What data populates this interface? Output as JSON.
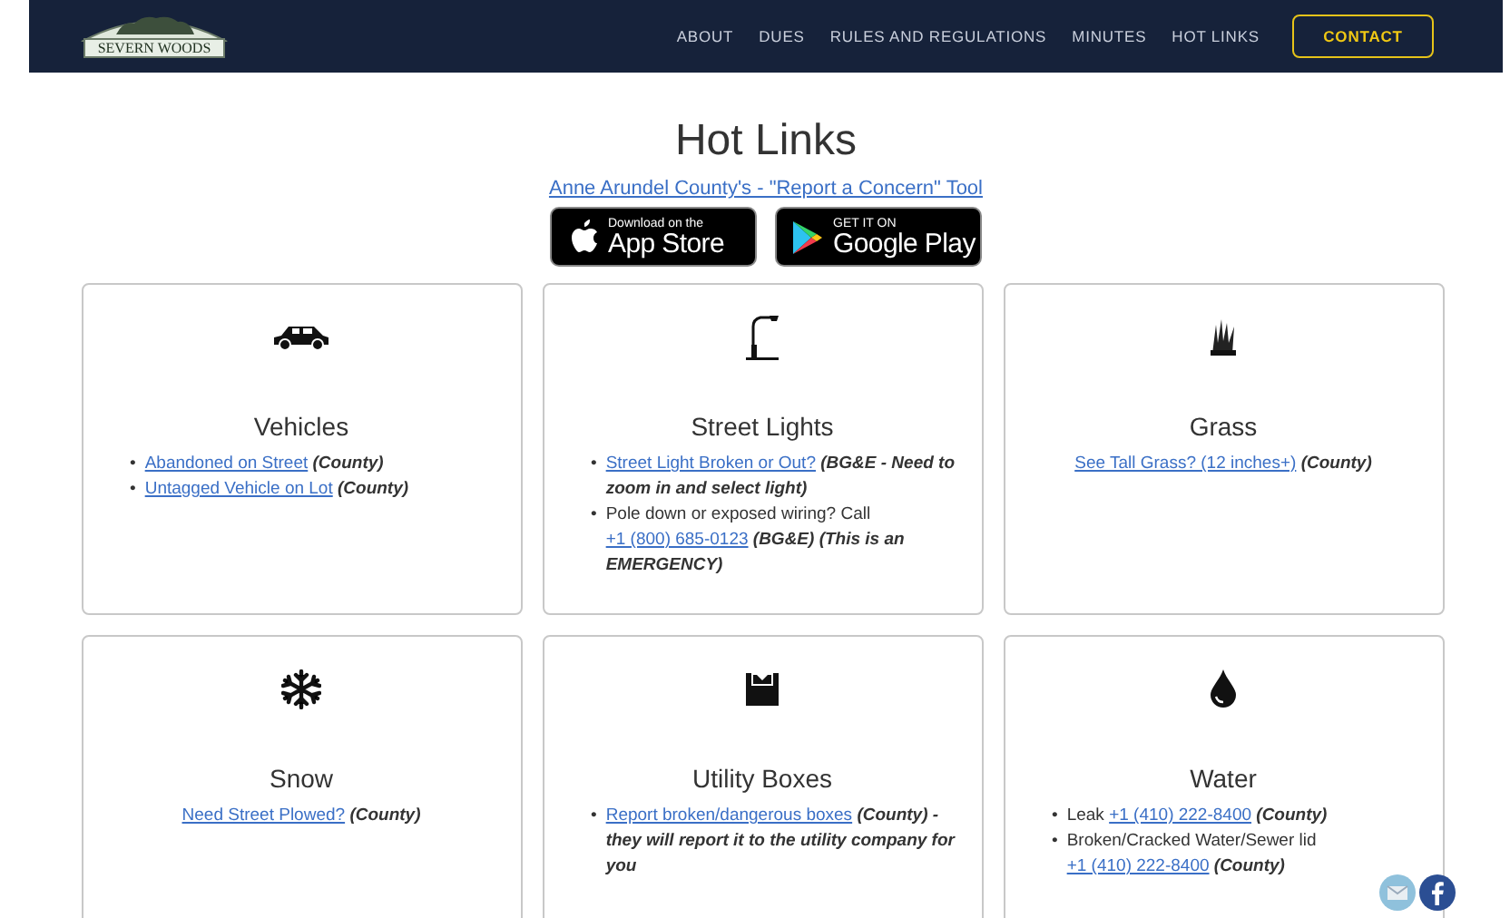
{
  "logo": {
    "text": "SEVERN WOODS"
  },
  "nav": {
    "links": [
      {
        "label": "ABOUT"
      },
      {
        "label": "DUES"
      },
      {
        "label": "RULES AND REGULATIONS"
      },
      {
        "label": "MINUTES"
      },
      {
        "label": "HOT LINKS"
      }
    ],
    "contact": "CONTACT"
  },
  "page": {
    "title": "Hot Links",
    "tool_link": "Anne Arundel County's - \"Report a Concern\" Tool",
    "badges": [
      {
        "kind": "apple",
        "top": "Download on the",
        "bottom": "App Store"
      },
      {
        "kind": "google",
        "top": "GET IT ON",
        "bottom": "Google Play"
      }
    ]
  },
  "cards": [
    {
      "title": "Vehicles",
      "items": [
        {
          "bullet": "•",
          "segments": [
            {
              "kind": "link",
              "text": "Abandoned on Street"
            },
            {
              "kind": "note",
              "text": "(County)"
            }
          ]
        },
        {
          "bullet": "•",
          "segments": [
            {
              "kind": "link",
              "text": "Untagged Vehicle on Lot"
            },
            {
              "kind": "note",
              "text": "(County)"
            }
          ]
        }
      ]
    },
    {
      "title": "Street Lights",
      "items": [
        {
          "bullet": "•",
          "segments": [
            {
              "kind": "link",
              "text": "Street Light Broken or Out?"
            },
            {
              "kind": "note",
              "text": "(BG&E - Need to zoom in and select light)"
            }
          ]
        },
        {
          "bullet": "•",
          "segments": [
            {
              "kind": "text",
              "text": "Pole down or exposed wiring? Call"
            },
            {
              "kind": "link",
              "text": "+1 (800) 685-0123"
            },
            {
              "kind": "note",
              "text": "(BG&E) (This is an EMERGENCY)"
            }
          ]
        }
      ]
    },
    {
      "title": "Grass",
      "items": [
        {
          "segments": [
            {
              "kind": "link",
              "text": "See Tall Grass? (12 inches+)"
            },
            {
              "kind": "note",
              "text": "(County)"
            }
          ]
        }
      ]
    },
    {
      "title": "Snow",
      "items": [
        {
          "segments": [
            {
              "kind": "link",
              "text": "Need Street Plowed?"
            },
            {
              "kind": "note",
              "text": "(County)"
            }
          ]
        }
      ]
    },
    {
      "title": "Utility Boxes",
      "items": [
        {
          "bullet": "•",
          "segments": [
            {
              "kind": "link",
              "text": "Report broken/dangerous boxes"
            },
            {
              "kind": "note",
              "text": "(County) - they will report it to the utility company for you"
            }
          ]
        }
      ]
    },
    {
      "title": "Water",
      "items": [
        {
          "bullet": "•",
          "segments": [
            {
              "kind": "text",
              "text": "Leak"
            },
            {
              "kind": "link",
              "text": "+1 (410) 222-8400"
            },
            {
              "kind": "note",
              "text": "(County)"
            }
          ]
        },
        {
          "bullet": "•",
          "segments": [
            {
              "kind": "text",
              "text": "Broken/Cracked Water/Sewer lid"
            },
            {
              "kind": "link",
              "text": "+1 (410) 222-8400"
            },
            {
              "kind": "note",
              "text": "(County)"
            }
          ]
        }
      ]
    }
  ]
}
